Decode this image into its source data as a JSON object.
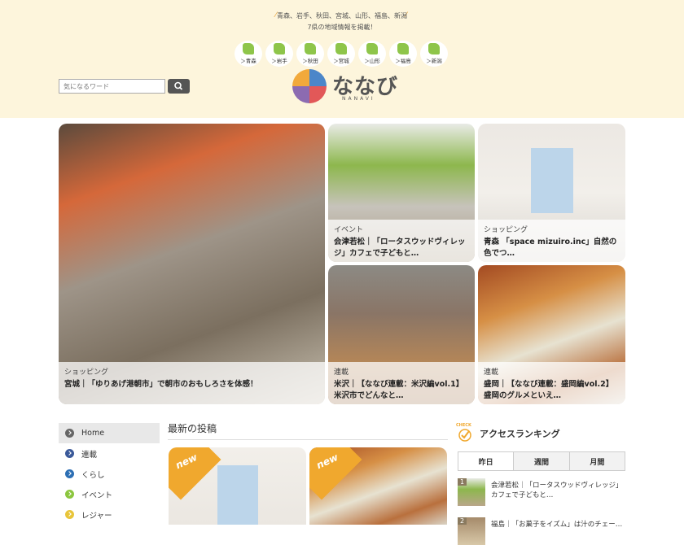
{
  "header": {
    "tagline_1": "青森、岩手、秋田、宮城、山形、福島、新潟",
    "tagline_2": "7県の地域情報を掲載！",
    "prefectures": [
      {
        "label": "＞青森"
      },
      {
        "label": "＞岩手"
      },
      {
        "label": "＞秋田"
      },
      {
        "label": "＞宮城"
      },
      {
        "label": "＞山形"
      },
      {
        "label": "＞福島"
      },
      {
        "label": "＞新潟"
      }
    ],
    "search_placeholder": "気になるワード",
    "logo_text": "ななび",
    "logo_sub": "NANAVI"
  },
  "featured": [
    {
      "category": "ショッピング",
      "title": "宮城｜「ゆりあげ港朝市」で朝市のおもしろさを体感！"
    },
    {
      "category": "イベント",
      "title": "会津若松｜「ロータスウッドヴィレッジ」カフェで子どもと…"
    },
    {
      "category": "ショッピング",
      "title": "青森 「space mizuiro.inc」自然の色でつ…"
    },
    {
      "category": "連載",
      "title": "米沢｜【ななび連載：米沢編vol.1】米沢市でどんなと…"
    },
    {
      "category": "連載",
      "title": "盛岡｜【ななび連載：盛岡編vol.2】盛岡のグルメといえ…"
    }
  ],
  "sidebar": {
    "items": [
      {
        "label": "Home",
        "color": "#666666"
      },
      {
        "label": "連載",
        "color": "#3b5a9a"
      },
      {
        "label": "くらし",
        "color": "#2d6fb4"
      },
      {
        "label": "イベント",
        "color": "#8cc63f"
      },
      {
        "label": "レジャー",
        "color": "#e8c53a"
      }
    ]
  },
  "latest": {
    "heading": "最新の投稿",
    "new_badge": "new"
  },
  "ranking": {
    "check_label": "CHECK",
    "heading": "アクセスランキング",
    "tabs": [
      "昨日",
      "週間",
      "月間"
    ],
    "items": [
      {
        "rank": "1",
        "title": "会津若松｜「ロータスウッドヴィレッジ」カフェで子どもと…"
      },
      {
        "rank": "2",
        "title": "福島｜「お菓子をイズム」は汁のチェー…"
      }
    ]
  },
  "colors": {
    "header_bg": "#fdf5dc",
    "accent": "#f0a82e"
  }
}
